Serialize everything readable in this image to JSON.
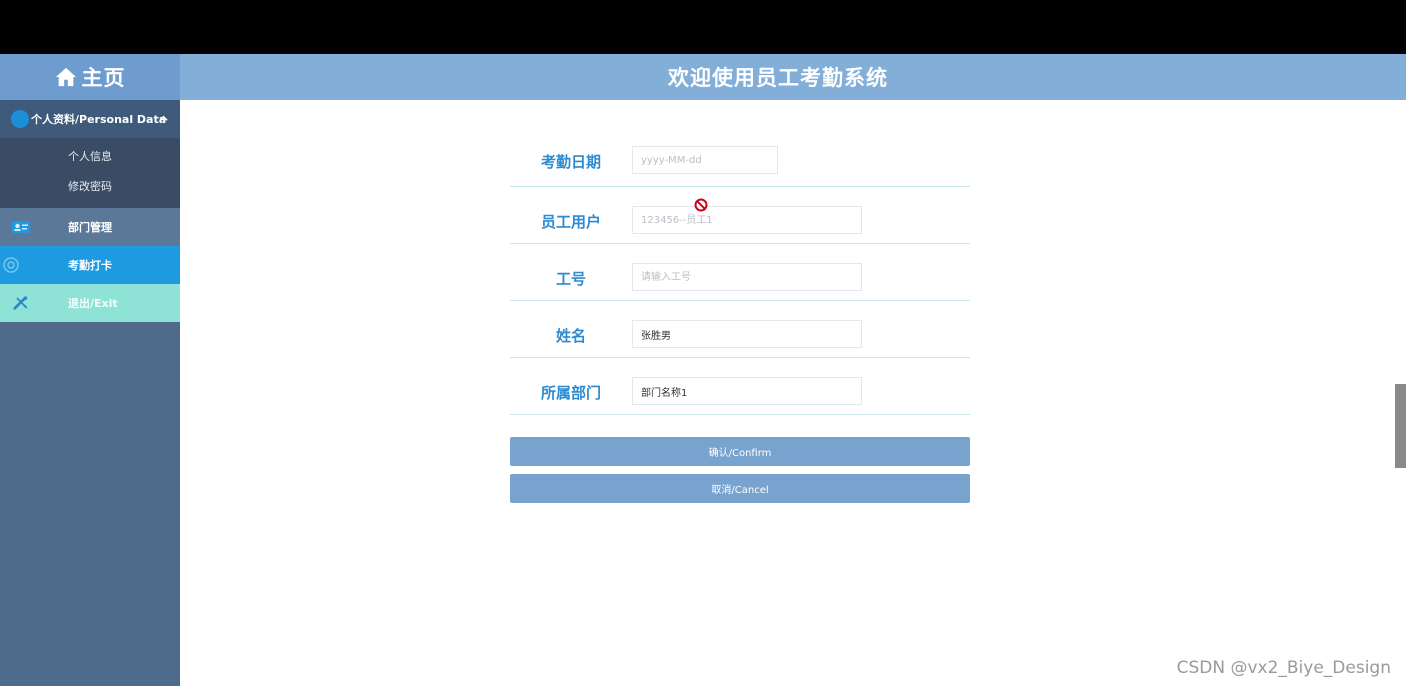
{
  "header": {
    "home_label": "主页",
    "site_title": "欢迎使用员工考勤系统"
  },
  "sidebar": {
    "group": {
      "label": "个人资料/Personal Data",
      "items": [
        "个人信息",
        "修改密码"
      ]
    },
    "items": [
      {
        "label": "部门管理",
        "icon": "id-card-icon"
      },
      {
        "label": "考勤打卡",
        "icon": "gear-icon"
      },
      {
        "label": "退出/Exit",
        "icon": "tools-icon"
      }
    ]
  },
  "form": {
    "fields": [
      {
        "label": "考勤日期",
        "value": "",
        "placeholder": "yyyy-MM-dd"
      },
      {
        "label": "员工用户",
        "value": "",
        "placeholder": "123456--员工1"
      },
      {
        "label": "工号",
        "value": "",
        "placeholder": "请输入工号"
      },
      {
        "label": "姓名",
        "value": "张胜男",
        "placeholder": ""
      },
      {
        "label": "所属部门",
        "value": "部门名称1",
        "placeholder": ""
      }
    ],
    "confirm_label": "确认/Confirm",
    "cancel_label": "取消/Cancel"
  },
  "colors": {
    "header": "#82aed8",
    "sidebar": "#4f6b8b",
    "active": "#1e9ae0",
    "exit": "#8fe2d6",
    "label": "#2e8bd1",
    "button": "#78a3cf"
  },
  "watermark": "CSDN @vx2_Biye_Design"
}
